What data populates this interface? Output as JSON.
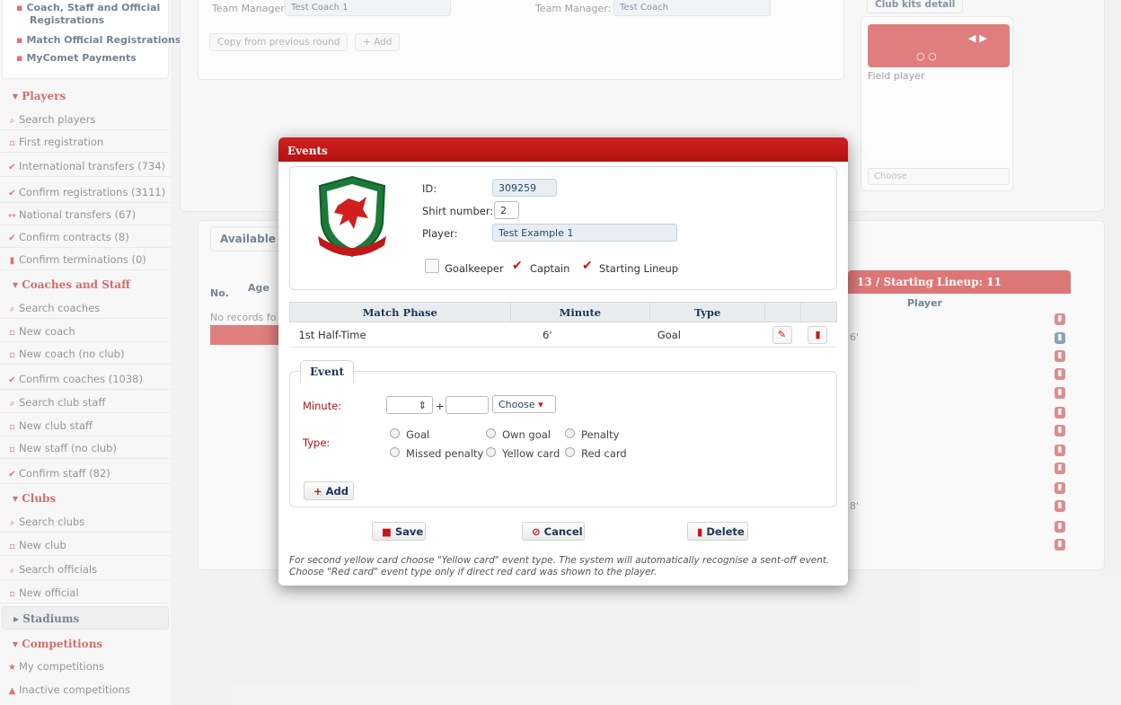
{
  "sidebar": {
    "top_items": [
      {
        "label": "Coach, Staff and Official",
        "icon": "document-icon"
      },
      {
        "label": "Registrations",
        "icon": ""
      },
      {
        "label": "Match Official Registrations",
        "icon": "document-icon"
      },
      {
        "label": "MyComet Payments",
        "icon": "document-icon"
      }
    ],
    "players_title": "Players",
    "players": [
      "Search players",
      "First registration",
      "International transfers (734)",
      "Confirm registrations (3111)",
      "National transfers (67)",
      "Confirm contracts (8)",
      "Confirm terminations (0)"
    ],
    "coaches_title": "Coaches and Staff",
    "coaches": [
      "Search coaches",
      "New coach",
      "New coach (no club)",
      "Confirm coaches (1038)",
      "Search club staff",
      "New club staff",
      "New staff (no club)",
      "Confirm staff (82)"
    ],
    "clubs_title": "Clubs",
    "clubs": [
      "Search clubs",
      "New club",
      "Search officials",
      "New official"
    ],
    "stadiums_title": "Stadiums",
    "competitions_title": "Competitions",
    "competitions": [
      "My competitions",
      "Inactive competitions"
    ]
  },
  "background": {
    "team_manager_label": "Team Manager:",
    "team_manager_value_1": "Test Coach 1",
    "team_manager_value_2": "Test Coach",
    "copy_button": "Copy from previous round",
    "add_button": "+ Add",
    "club_kits_tab": "Club kits detail",
    "field_player": "Field player",
    "choose": "Choose",
    "available_tab": "Available p",
    "col_no": "No.",
    "col_age": "Age",
    "no_records": "No records fo",
    "lineup_bar": "13 / Starting Lineup: 11",
    "col_player": "Player",
    "minute_6": "6'",
    "minute_8": "8'"
  },
  "modal": {
    "title": "Events",
    "id_label": "ID:",
    "id_value": "309259",
    "shirt_label": "Shirt number:",
    "shirt_value": "2",
    "player_label": "Player:",
    "player_value": "Test Example 1",
    "goalkeeper_label": "Goalkeeper",
    "captain_label": "Captain",
    "starting_label": "Starting Lineup",
    "table_headers": [
      "Match Phase",
      "Minute",
      "Type"
    ],
    "rows": [
      {
        "phase": "1st Half-Time",
        "minute": "6'",
        "type": "Goal"
      }
    ],
    "event_tab": "Event",
    "minute_label": "Minute:",
    "plus": "+",
    "choose": "Choose",
    "type_label": "Type:",
    "types": [
      "Goal",
      "Own goal",
      "Penalty",
      "Missed penalty",
      "Yellow card",
      "Red card"
    ],
    "add_label": "Add",
    "save_label": "Save",
    "cancel_label": "Cancel",
    "delete_label": "Delete",
    "note": "For second yellow card choose \"Yellow card\" event type. The system will automatically recognise a sent-off event. Choose \"Red card\" event type only if direct red card was shown to the player."
  },
  "colors": {
    "accent_red": "#c21818",
    "navy": "#1c3657"
  }
}
